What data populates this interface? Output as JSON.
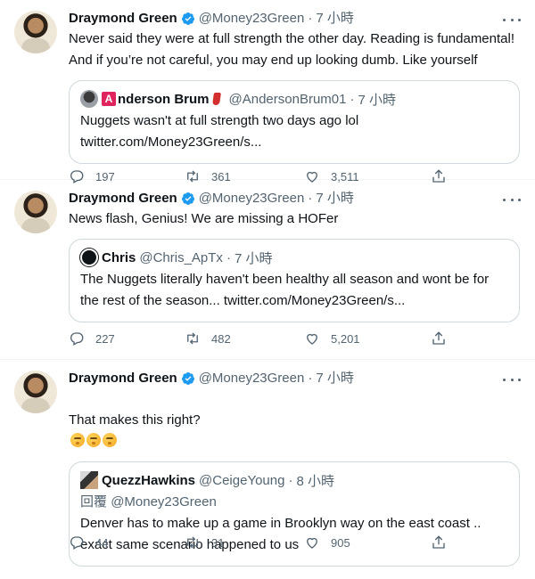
{
  "colors": {
    "verified": "#1d9bf0",
    "secondary_text": "#536471",
    "border": "#cfd9de",
    "divider": "#eff3f4"
  },
  "tweets": [
    {
      "author_name": "Draymond Green",
      "author_handle": "@Money23Green",
      "time": "7 小時",
      "text": "Never said they were at full strength the other day. Reading is fundamental!\nAnd if you’re not careful, you may end up looking dumb. Like yourself",
      "quote": {
        "name_badge": "A",
        "name": "nderson Brum",
        "handle": "@AndersonBrum01",
        "time": "7 小時",
        "text": "Nuggets wasn't at full strength two days ago lol\ntwitter.com/Money23Green/s..."
      },
      "replies": "197",
      "retweets": "361",
      "likes": "3,511"
    },
    {
      "author_name": "Draymond Green",
      "author_handle": "@Money23Green",
      "time": "7 小時",
      "text": "News flash, Genius! We are missing a HOFer",
      "quote": {
        "name": "Chris",
        "handle": "@Chris_ApTx",
        "time": "7 小時",
        "text": "The Nuggets literally haven't been healthy all season and wont be for\nthe rest of the season... twitter.com/Money23Green/s..."
      },
      "replies": "227",
      "retweets": "482",
      "likes": "5,201"
    },
    {
      "author_name": "Draymond Green",
      "author_handle": "@Money23Green",
      "time": "7 小時",
      "text": "That makes this right?",
      "emojis": [
        "thinking-face",
        "thinking-face",
        "thinking-face"
      ],
      "quote": {
        "name": "QuezzHawkins",
        "handle": "@CeigeYoung",
        "time": "8 小時",
        "reply_prefix": "回覆",
        "reply_to": "@Money23Green",
        "text": "Denver has to make up a game in Brooklyn way on the east coast ..\nexact same scenario happened to us"
      },
      "replies": "44",
      "retweets": "31",
      "likes": "905"
    }
  ]
}
